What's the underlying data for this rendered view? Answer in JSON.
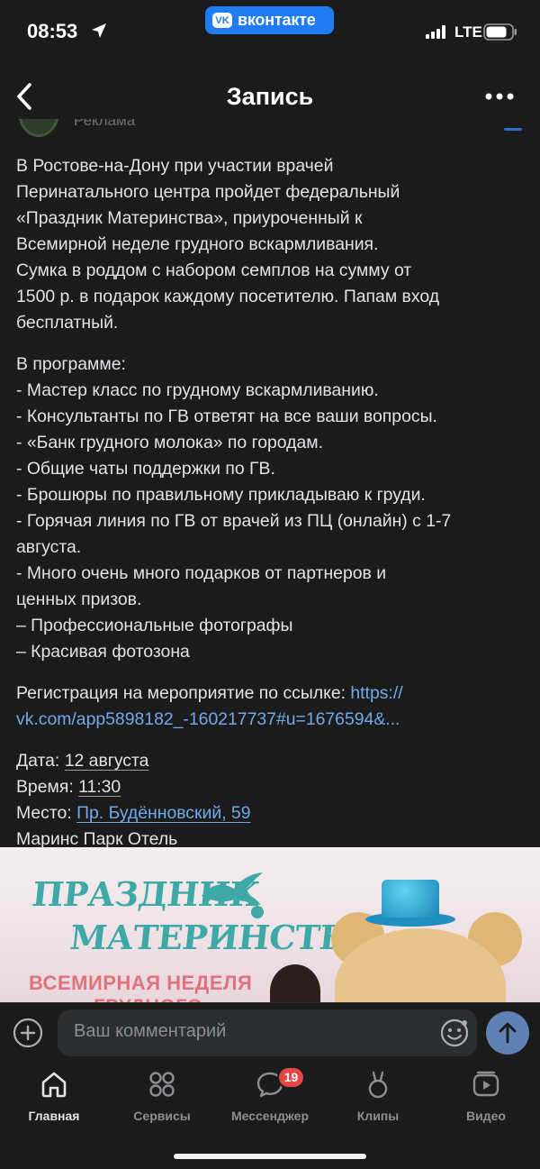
{
  "status": {
    "time": "08:53",
    "app_pill": "вконтакте",
    "app_pill_logo": "VK",
    "network": "LTE"
  },
  "header": {
    "title": "Запись"
  },
  "post": {
    "author_subtitle": "Реклама",
    "intro_lines": [
      "В Ростове-на-Дону при участии врачей",
      "Перинатального центра пройдет федеральный",
      "«Праздник Материнства», приуроченный к",
      "Всемирной неделе грудного вскармливания.",
      "Сумка в роддом с набором семплов на сумму от",
      "1500 р. в подарок каждому посетителю. Папам вход",
      "бесплатный."
    ],
    "program_lines": [
      "В программе:",
      "- Мастер класс по грудному вскармливанию.",
      "- Консультанты по ГВ ответят на все ваши вопросы.",
      "- «Банк грудного молока» по городам.",
      "- Общие чаты поддержки по ГВ.",
      "- Брошюры по правильному прикладываю к груди.",
      "- Горячая линия по ГВ от врачей из ПЦ (онлайн) с 1-7",
      "августа.",
      "- Много очень много подарков от партнеров и",
      "ценных призов.",
      "– Профессиональные фотографы",
      "– Красивая фотозона"
    ],
    "registration_text": "Регистрация на мероприятие по ссылке: ",
    "registration_link_part1": "https://",
    "registration_link_part2": "vk.com/app5898182_-160217737#u=1676594&...",
    "date_label": "Дата: ",
    "date_value": "12 августа",
    "time_label": "Время: ",
    "time_value": "11:30",
    "place_label": "Место: ",
    "place_value": "Пр. Будённовский, 59",
    "venue": "Маринс Парк Отель"
  },
  "banner": {
    "title_line1": "ПРАЗДНИК",
    "title_line2": "МАТЕРИНСТВА",
    "subtitle_line1": "ВСЕМИРНАЯ НЕДЕЛЯ",
    "subtitle_line2": "ГРУДНОГО"
  },
  "comment": {
    "placeholder": "Ваш комментарий"
  },
  "tabbar": {
    "tabs": [
      {
        "label": "Главная",
        "icon": "home-icon"
      },
      {
        "label": "Сервисы",
        "icon": "services-icon"
      },
      {
        "label": "Мессенджер",
        "icon": "messenger-icon",
        "badge": "19"
      },
      {
        "label": "Клипы",
        "icon": "clips-icon"
      },
      {
        "label": "Видео",
        "icon": "video-icon"
      }
    ],
    "active_tab": "Главная"
  },
  "colors": {
    "background": "#1b1b1c",
    "text": "#e2e3e6",
    "link": "#71aaeb",
    "accent": "#1f7cf2",
    "badge": "#e64646"
  }
}
